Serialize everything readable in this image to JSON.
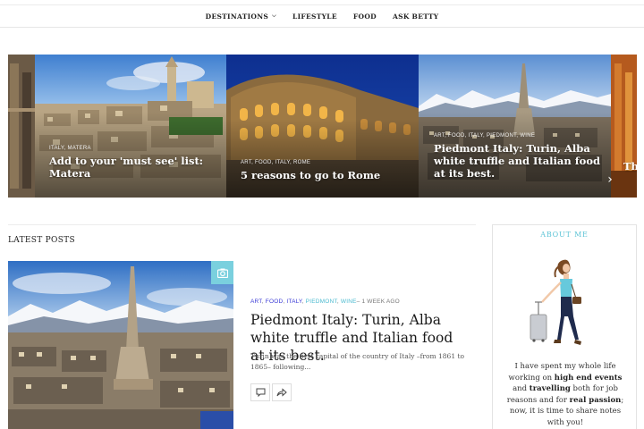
{
  "nav": {
    "items": [
      {
        "label": "DESTINATIONS",
        "has_dropdown": true
      },
      {
        "label": "LIFESTYLE",
        "has_dropdown": false
      },
      {
        "label": "FOOD",
        "has_dropdown": false
      },
      {
        "label": "ASK BETTY",
        "has_dropdown": false
      }
    ]
  },
  "slider": {
    "slides": [
      {
        "cats": "ITALY, MATERA",
        "title": "Add to your 'must see' list: Matera"
      },
      {
        "cats": "ART, FOOD, ITALY, ROME",
        "title": "5 reasons to go to Rome"
      },
      {
        "cats": "ART, FOOD, ITALY, PIEDMONT, WINE",
        "title": "Piedmont Italy: Turin, Alba white truffle and Italian food at its best."
      },
      {
        "cats": "",
        "title": "Th"
      }
    ],
    "next_icon": "chevron-right-icon"
  },
  "latest": {
    "heading": "LATEST POSTS",
    "post": {
      "cats": [
        "ART",
        "FOOD",
        "ITALY",
        "PIEDMONT",
        "WINE"
      ],
      "time": "1 WEEK AGO",
      "title": "Piedmont Italy: Turin, Alba white truffle and Italian food at its best.",
      "excerpt": "Turin was the first capital of the country of Italy –from 1861 to 1865– following...",
      "badge_icon": "camera-icon",
      "actions": [
        "comment-icon",
        "share-icon"
      ]
    }
  },
  "sidebar": {
    "about_title": "ABOUT ME",
    "about_text": {
      "p1": "I have spent my whole life working on ",
      "b1": "high end events",
      "p2": " and ",
      "b2": "travelling",
      "p3": " both for job reasons and for ",
      "b3": "real passion",
      "p4": "; now, it is time to share notes with you!"
    }
  },
  "colors": {
    "accent": "#5ec4d6",
    "badge": "#7ad0de",
    "category_link": "#3b3bd6"
  }
}
